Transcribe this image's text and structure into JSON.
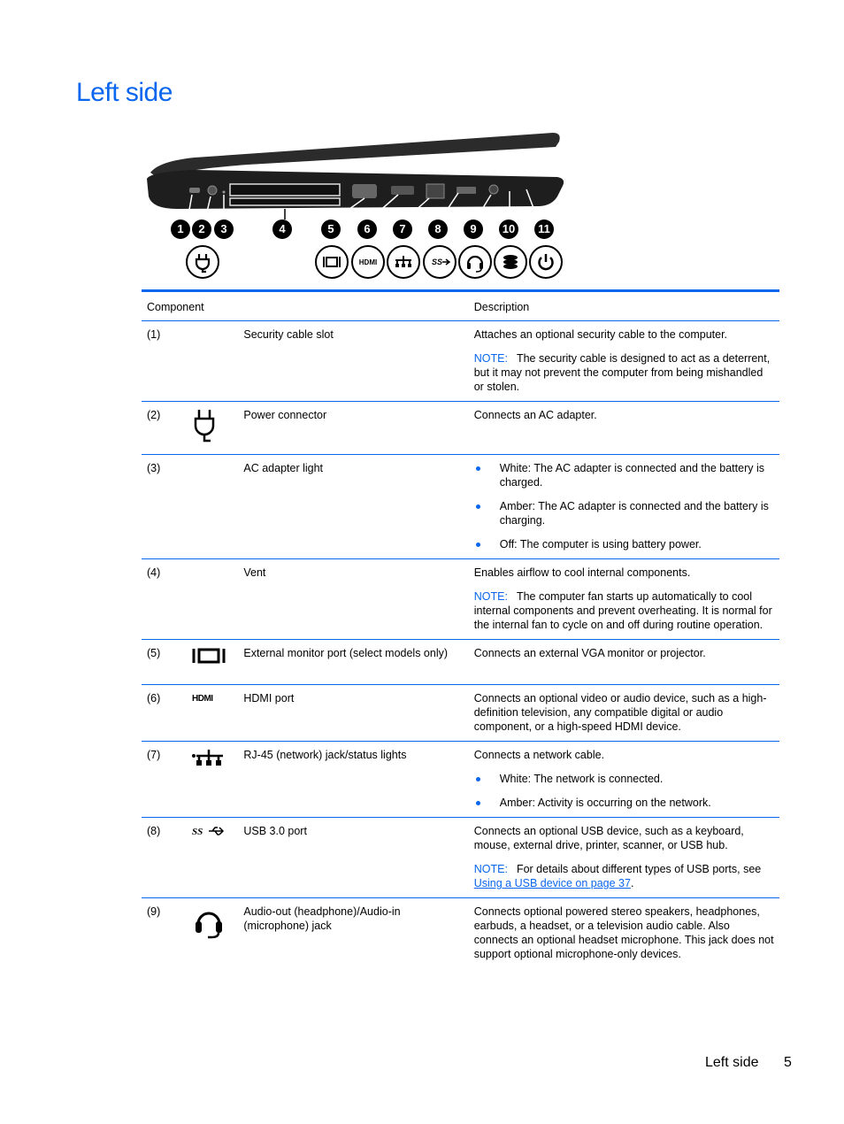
{
  "page": {
    "title": "Left side",
    "accent_color": "#0a66ee"
  },
  "figure": {
    "callouts": [
      "1",
      "2",
      "3",
      "4",
      "5",
      "6",
      "7",
      "8",
      "9",
      "10",
      "11"
    ],
    "icon_row": [
      "power-plug-icon",
      "vga-monitor-icon",
      "hdmi-icon",
      "network-rj45-icon",
      "usb-3-ss-icon",
      "headset-icon",
      "hard-drive-icon",
      "power-icon"
    ]
  },
  "table": {
    "headers": {
      "component": "Component",
      "description": "Description"
    },
    "rows": [
      {
        "num": "(1)",
        "icon": "",
        "name": "Security cable slot",
        "desc": "Attaches an optional security cable to the computer.",
        "note_label": "NOTE:",
        "note": "The security cable is designed to act as a deterrent, but it may not prevent the computer from being mishandled or stolen."
      },
      {
        "num": "(2)",
        "icon": "power-plug-icon",
        "name": "Power connector",
        "desc": "Connects an AC adapter."
      },
      {
        "num": "(3)",
        "icon": "",
        "name": "AC adapter light",
        "bullets": [
          "White: The AC adapter is connected and the battery is charged.",
          "Amber: The AC adapter is connected and the battery is charging.",
          "Off: The computer is using battery power."
        ]
      },
      {
        "num": "(4)",
        "icon": "",
        "name": "Vent",
        "desc": "Enables airflow to cool internal components.",
        "note_label": "NOTE:",
        "note": "The computer fan starts up automatically to cool internal components and prevent overheating. It is normal for the internal fan to cycle on and off during routine operation."
      },
      {
        "num": "(5)",
        "icon": "vga-monitor-icon",
        "name": "External monitor port (select models only)",
        "desc": "Connects an external VGA monitor or projector."
      },
      {
        "num": "(6)",
        "icon": "hdmi-icon",
        "name": "HDMI port",
        "desc": "Connects an optional video or audio device, such as a high-definition television, any compatible digital or audio component, or a high-speed HDMI device."
      },
      {
        "num": "(7)",
        "icon": "network-rj45-icon",
        "name": "RJ-45 (network) jack/status lights",
        "desc": "Connects a network cable.",
        "bullets": [
          "White: The network is connected.",
          "Amber: Activity is occurring on the network."
        ]
      },
      {
        "num": "(8)",
        "icon": "usb-3-ss-icon",
        "name": "USB 3.0 port",
        "desc": "Connects an optional USB device, such as a keyboard, mouse, external drive, printer, scanner, or USB hub.",
        "note_label": "NOTE:",
        "note": "For details about different types of USB ports, see",
        "note_link": "Using a USB device on page 37",
        "note_end": "."
      },
      {
        "num": "(9)",
        "icon": "headset-icon",
        "name": "Audio-out (headphone)/Audio-in (microphone) jack",
        "desc": "Connects optional powered stereo speakers, headphones, earbuds, a headset, or a television audio cable. Also connects an optional headset microphone. This jack does not support optional microphone-only devices."
      }
    ]
  },
  "footer": {
    "section": "Left side",
    "page_number": "5"
  }
}
